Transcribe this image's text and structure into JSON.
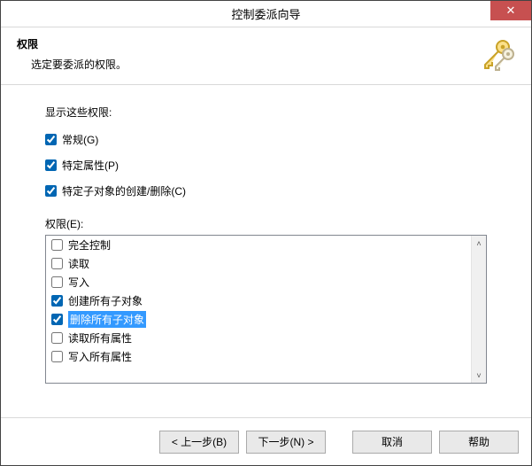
{
  "window": {
    "title": "控制委派向导",
    "close_glyph": "✕"
  },
  "header": {
    "title": "权限",
    "subtitle": "选定要委派的权限。"
  },
  "body": {
    "show_label": "显示这些权限:",
    "filter": {
      "general": {
        "label": "常规(G)",
        "checked": true
      },
      "property": {
        "label": "特定属性(P)",
        "checked": true
      },
      "childobj": {
        "label": "特定子对象的创建/删除(C)",
        "checked": true
      }
    },
    "perm_label": "权限(E):",
    "permissions": [
      {
        "label": "完全控制",
        "checked": false,
        "selected": false
      },
      {
        "label": "读取",
        "checked": false,
        "selected": false
      },
      {
        "label": "写入",
        "checked": false,
        "selected": false
      },
      {
        "label": "创建所有子对象",
        "checked": true,
        "selected": false
      },
      {
        "label": "删除所有子对象",
        "checked": true,
        "selected": true
      },
      {
        "label": "读取所有属性",
        "checked": false,
        "selected": false
      },
      {
        "label": "写入所有属性",
        "checked": false,
        "selected": false
      }
    ]
  },
  "footer": {
    "back": "< 上一步(B)",
    "next": "下一步(N) >",
    "cancel": "取消",
    "help": "帮助"
  }
}
